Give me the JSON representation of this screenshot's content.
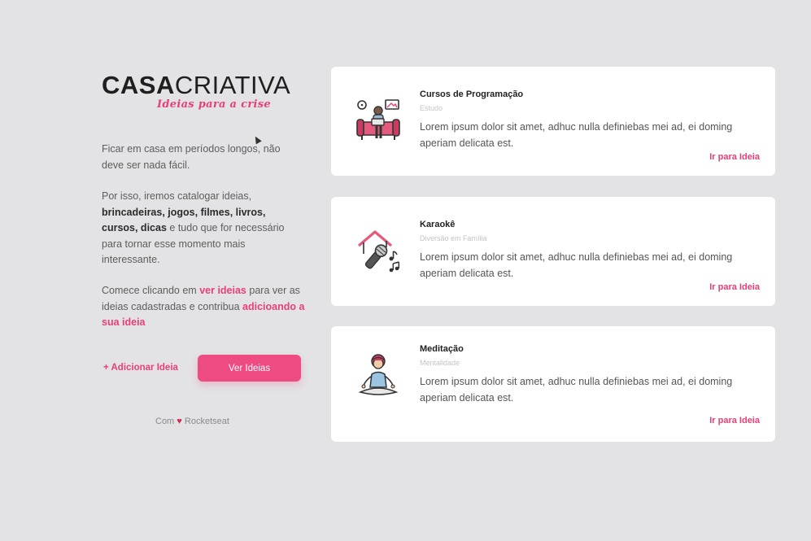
{
  "brand": {
    "logo_bold": "CASA",
    "logo_light": "CRIATIVA",
    "tagline": "Ideias para a crise"
  },
  "intro": {
    "p1": "Ficar em casa em períodos longos, não deve ser nada fácil.",
    "p2_start": "Por isso, iremos catalogar ideias,",
    "p2_bold": "brincadeiras, jogos, filmes, livros, cursos, dicas",
    "p2_end": "e tudo que for necessário para tornar esse momento mais interessante.",
    "p3_start": "Comece clicando em",
    "p3_link1": "ver ideias",
    "p3_mid": "para ver as  ideias cadastradas e contribua",
    "p3_link2": "adicioando a sua ideia"
  },
  "actions": {
    "add_label": "+ Adicionar Ideia",
    "see_label": "Ver Ideias"
  },
  "footer": {
    "prefix": "Com",
    "heart": "♥",
    "suffix": "Rocketseat"
  },
  "ideas": [
    {
      "title": "Cursos de Programação",
      "category": "Estudo",
      "description": "Lorem ipsum dolor sit amet, adhuc nulla definiebas mei ad, ei doming aperiam delicata est.",
      "link": "Ir para Ideia",
      "icon": "programming-couch-icon"
    },
    {
      "title": "Karaokê",
      "category": "Diversão em Família",
      "description": "Lorem ipsum dolor sit amet, adhuc nulla definiebas mei ad, ei doming aperiam delicata est.",
      "link": "Ir para Ideia",
      "icon": "karaoke-microphone-icon"
    },
    {
      "title": "Meditação",
      "category": "Mentalidade",
      "description": "Lorem ipsum dolor sit amet, adhuc nulla definiebas mei ad, ei doming aperiam delicata est.",
      "link": "Ir para Ideia",
      "icon": "meditation-icon"
    }
  ],
  "colors": {
    "accent": "#e83f77",
    "button": "#ee4b82",
    "background": "#e3e3e5",
    "card": "#ffffff"
  }
}
